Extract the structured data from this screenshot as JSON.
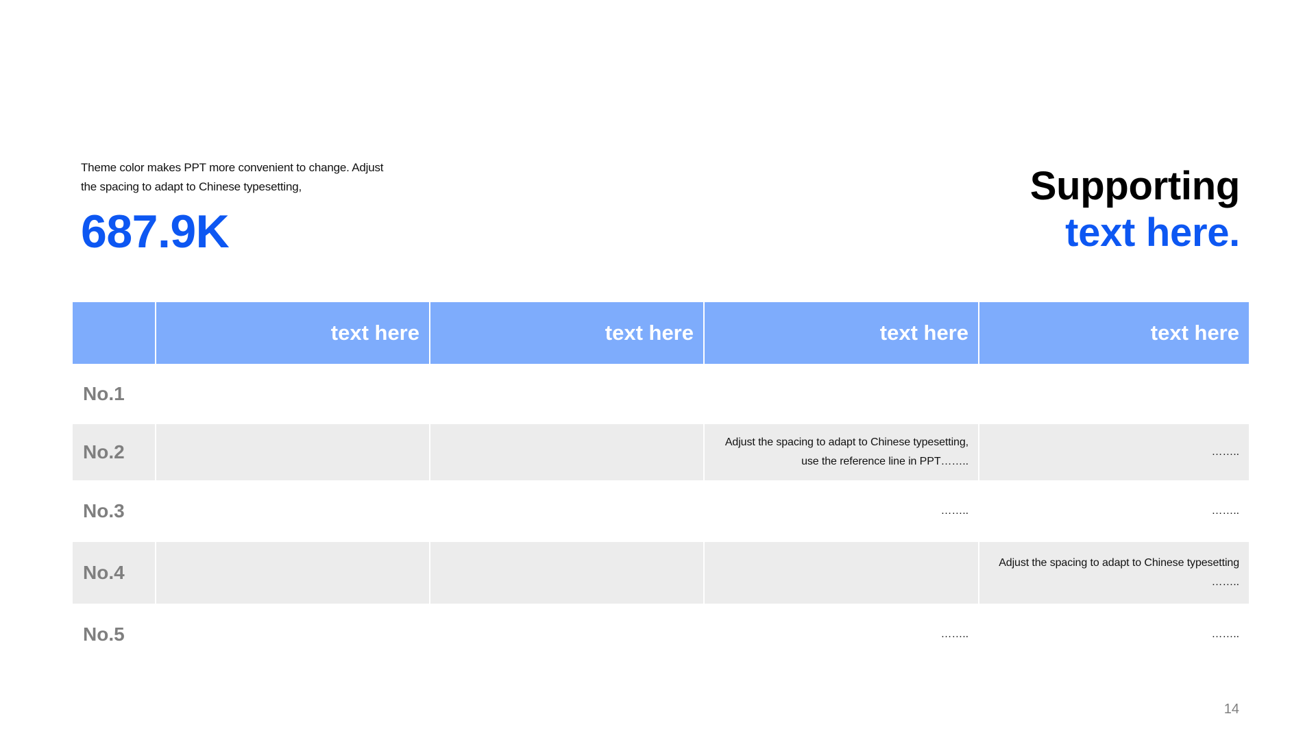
{
  "intro": {
    "description": "Theme color makes PPT more convenient  to change.  Adjust the spacing to adapt to Chinese typesetting,",
    "big_number": "687.9K"
  },
  "supporting": {
    "line1": "Supporting",
    "line2": "text here."
  },
  "colors": {
    "accent": "#0d57f2",
    "header_bg": "#7eacfc",
    "stripe_bg": "#ececec",
    "label_gray": "#7f7f7f"
  },
  "table": {
    "headers": [
      "",
      "text here",
      "text here",
      "text here",
      "text here"
    ],
    "rows": [
      {
        "label": "No.1",
        "cells": [
          "",
          "",
          "",
          ""
        ]
      },
      {
        "label": "No.2",
        "cells": [
          "",
          "",
          "Adjust the spacing to adapt to Chinese typesetting,\nuse the reference line in PPT……..",
          "…….."
        ]
      },
      {
        "label": "No.3",
        "cells": [
          "",
          "",
          "……..",
          "…….."
        ]
      },
      {
        "label": "No.4",
        "cells": [
          "",
          "",
          "",
          "Adjust the spacing to adapt to Chinese typesetting\n…….."
        ]
      },
      {
        "label": "No.5",
        "cells": [
          "",
          "",
          "……..",
          "…….."
        ]
      }
    ]
  },
  "page_number": "14"
}
